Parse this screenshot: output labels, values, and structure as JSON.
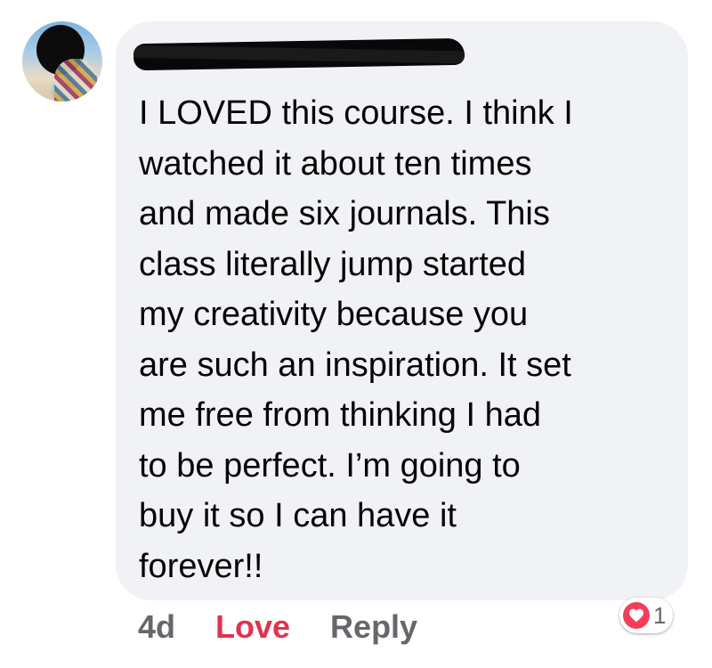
{
  "comment": {
    "author_name": "",
    "lines": [
      "I LOVED this course. I think I",
      "watched it about ten times",
      "and made six journals. This",
      "class literally jump started",
      "my creativity because you",
      "are such an inspiration. It set",
      "me free from thinking I had",
      "to be perfect. I’m going to",
      "buy it so I can have it",
      "forever!!"
    ]
  },
  "actions": {
    "time": "4d",
    "love_label": "Love",
    "reply_label": "Reply"
  },
  "reaction": {
    "icon": "heart-icon",
    "count": "1",
    "color": "#f33e58"
  },
  "colors": {
    "bubble": "#f0f2f5",
    "love_active": "#e0334f",
    "meta_text": "#65676b"
  }
}
